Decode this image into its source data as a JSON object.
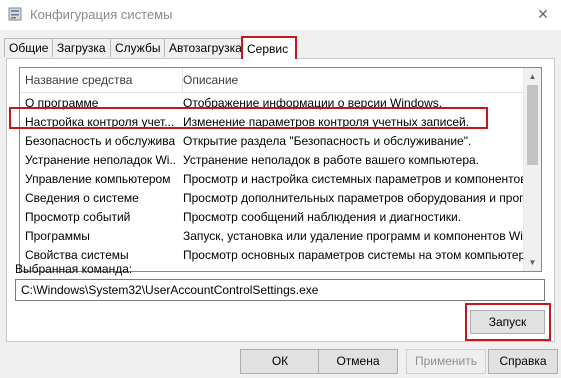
{
  "window": {
    "title": "Конфигурация системы"
  },
  "tabs": [
    {
      "label": "Общие"
    },
    {
      "label": "Загрузка"
    },
    {
      "label": "Службы"
    },
    {
      "label": "Автозагрузка"
    },
    {
      "label": "Сервис",
      "active": true
    }
  ],
  "tools_list": {
    "headers": {
      "name": "Название средства",
      "description": "Описание"
    },
    "rows": [
      {
        "name": "О программе",
        "description": "Отображение информации о версии Windows."
      },
      {
        "name": "Настройка контроля учет...",
        "description": "Изменение параметров контроля учетных записей.",
        "highlighted": true
      },
      {
        "name": "Безопасность и обслужива...",
        "description": "Открытие раздела \"Безопасность и обслуживание\"."
      },
      {
        "name": "Устранение неполадок Wi...",
        "description": "Устранение неполадок в работе вашего компьютера."
      },
      {
        "name": "Управление компьютером",
        "description": "Просмотр и настройка системных параметров и компонентов."
      },
      {
        "name": "Сведения о системе",
        "description": "Просмотр дополнительных параметров оборудования и программ"
      },
      {
        "name": "Просмотр событий",
        "description": "Просмотр сообщений наблюдения и диагностики."
      },
      {
        "name": "Программы",
        "description": "Запуск, установка или удаление программ и компонентов Windows."
      },
      {
        "name": "Свойства системы",
        "description": "Просмотр основных параметров системы на этом компьютере."
      }
    ]
  },
  "command": {
    "label": "Выбранная команда:",
    "value": "C:\\Windows\\System32\\UserAccountControlSettings.exe"
  },
  "buttons": {
    "launch": "Запуск",
    "ok": "ОК",
    "cancel": "Отмена",
    "apply": "Применить",
    "help": "Справка"
  },
  "highlight_color": "#c8161d",
  "icons": {
    "app": "msconfig-icon",
    "close": "close-icon"
  }
}
